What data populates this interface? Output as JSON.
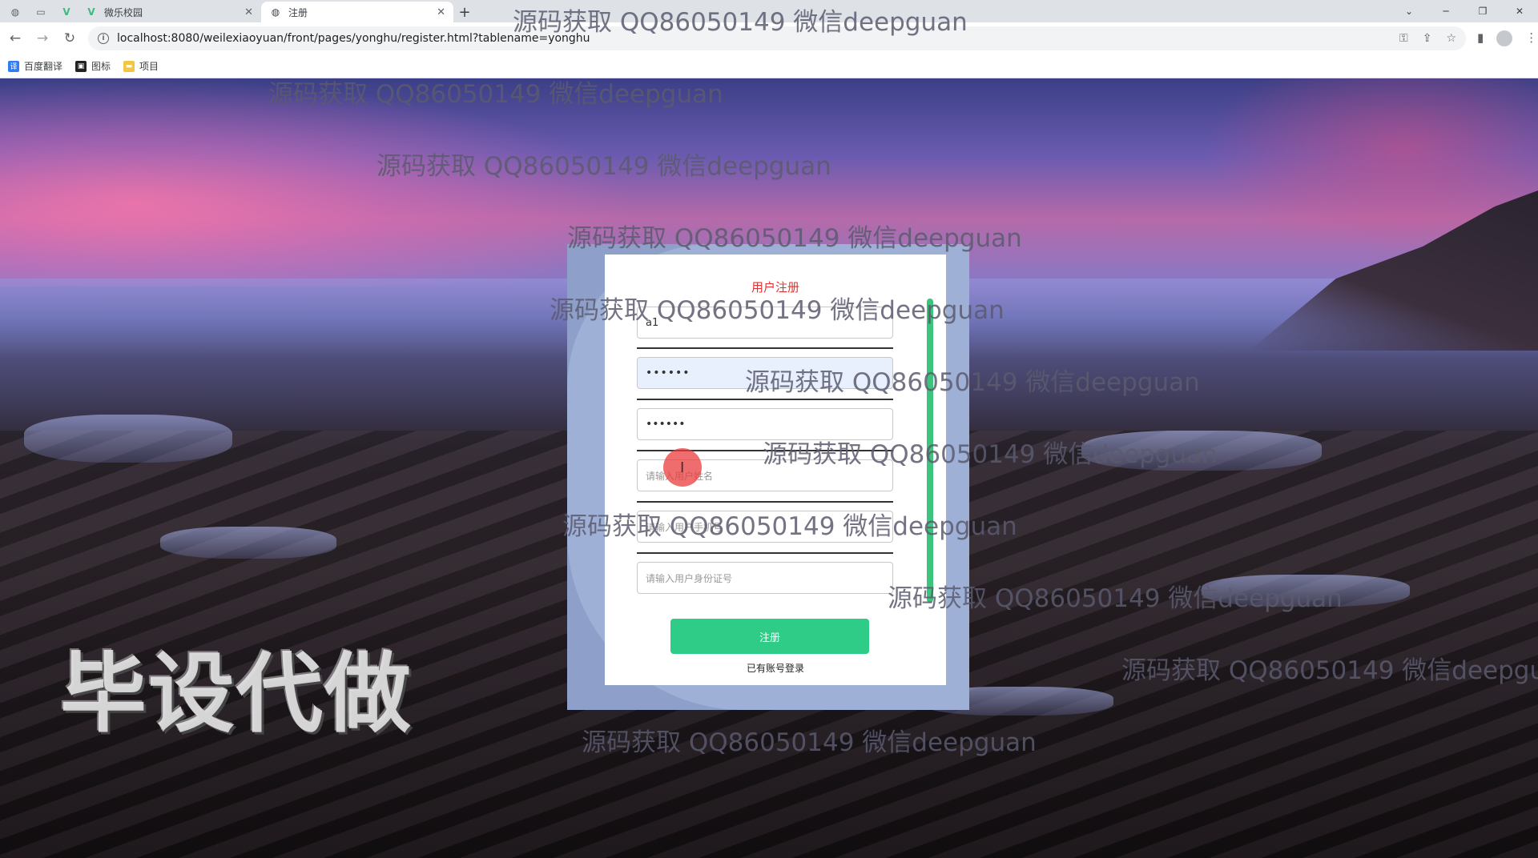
{
  "browser": {
    "tabs": [
      {
        "title": "微乐校园",
        "active": false
      },
      {
        "title": "注册",
        "active": true
      }
    ],
    "new_tab_symbol": "+",
    "url": "localhost:8080/weilexiaoyuan/front/pages/yonghu/register.html?tablename=yonghu",
    "bookmarks": [
      "百度翻译",
      "图标",
      "项目"
    ]
  },
  "register": {
    "title": "用户注册",
    "fields": [
      {
        "value": "a1",
        "placeholder": ""
      },
      {
        "value": "••••••",
        "placeholder": ""
      },
      {
        "value": "••••••",
        "placeholder": ""
      },
      {
        "value": "",
        "placeholder": "请输入用户姓名"
      },
      {
        "value": "",
        "placeholder": "请输入用户手机号"
      },
      {
        "value": "",
        "placeholder": "请输入用户身份证号"
      }
    ],
    "submit_label": "注册",
    "login_link": "已有账号登录"
  },
  "overlay_text": "毕设代做",
  "watermark_text": "源码获取 QQ86050149 微信deepguan",
  "icons": {
    "back": "arrow-left-icon",
    "forward": "arrow-right-icon",
    "reload": "reload-icon",
    "info": "info-icon",
    "key": "key-icon",
    "share": "share-icon",
    "star": "star-icon",
    "sidebar": "sidebar-icon",
    "profile": "profile-icon",
    "menu": "kebab-menu-icon"
  },
  "colors": {
    "title_red": "#e03232",
    "button_green": "#2ecc86",
    "card_frame": "#9eb0d6"
  }
}
